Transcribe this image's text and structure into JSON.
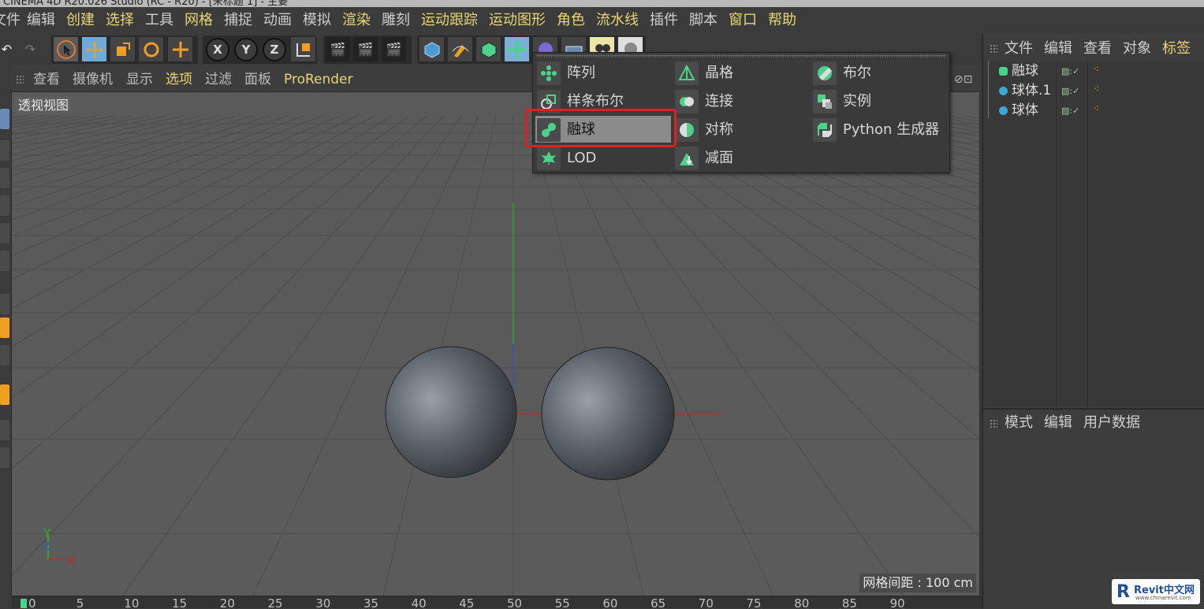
{
  "title": {
    "text": "CINEMA 4D R20.026 Studio (RC - R20) - [未标题 1] - 主要"
  },
  "menu": [
    "文件",
    "编辑",
    "创建",
    "选择",
    "工具",
    "网格",
    "捕捉",
    "动画",
    "模拟",
    "渲染",
    "雕刻",
    "运动跟踪",
    "运动图形",
    "角色",
    "流水线",
    "插件",
    "脚本",
    "窗口",
    "帮助"
  ],
  "toolbar": {
    "axis_x": "X",
    "axis_y": "Y",
    "axis_z": "Z"
  },
  "viewport": {
    "menu": [
      "查看",
      "摄像机",
      "显示",
      "选项",
      "过滤",
      "面板",
      "ProRender"
    ],
    "label": "透视视图",
    "grid_info": "网格间距 : 100 cm",
    "axis_y": "Y",
    "axis_x": "X",
    "axis_z": "Z"
  },
  "dropdown": {
    "items": [
      {
        "label": "阵列",
        "icon": "array-icon"
      },
      {
        "label": "样条布尔",
        "icon": "spline-boolean-icon"
      },
      {
        "label": "融球",
        "icon": "metaball-icon",
        "selected": true
      },
      {
        "label": "LOD",
        "icon": "lod-icon"
      },
      {
        "label": "晶格",
        "icon": "atom-array-icon"
      },
      {
        "label": "连接",
        "icon": "connect-icon"
      },
      {
        "label": "对称",
        "icon": "symmetry-icon"
      },
      {
        "label": "减面",
        "icon": "polygon-reduction-icon"
      },
      {
        "label": "布尔",
        "icon": "boole-icon"
      },
      {
        "label": "实例",
        "icon": "instance-icon"
      },
      {
        "label": "Python 生成器",
        "icon": "python-icon"
      }
    ]
  },
  "object_manager": {
    "menu": [
      "文件",
      "编辑",
      "查看",
      "对象",
      "标签"
    ],
    "objects": [
      {
        "name": "融球"
      },
      {
        "name": "球体.1"
      },
      {
        "name": "球体"
      }
    ]
  },
  "attribute_manager": {
    "menu": [
      "模式",
      "编辑",
      "用户数据"
    ]
  },
  "timeline": {
    "ticks": [
      "0",
      "5",
      "10",
      "15",
      "20",
      "25",
      "30",
      "35",
      "40",
      "45",
      "50",
      "55",
      "60",
      "65",
      "70",
      "75",
      "80",
      "85",
      "90"
    ]
  },
  "watermark": {
    "brand": "Revit中文网",
    "url": "www.chinarevit.com"
  },
  "colors": {
    "highlight": "#e6d675",
    "selection_box": "#e02020",
    "object_icon": "#3ba7d8"
  }
}
